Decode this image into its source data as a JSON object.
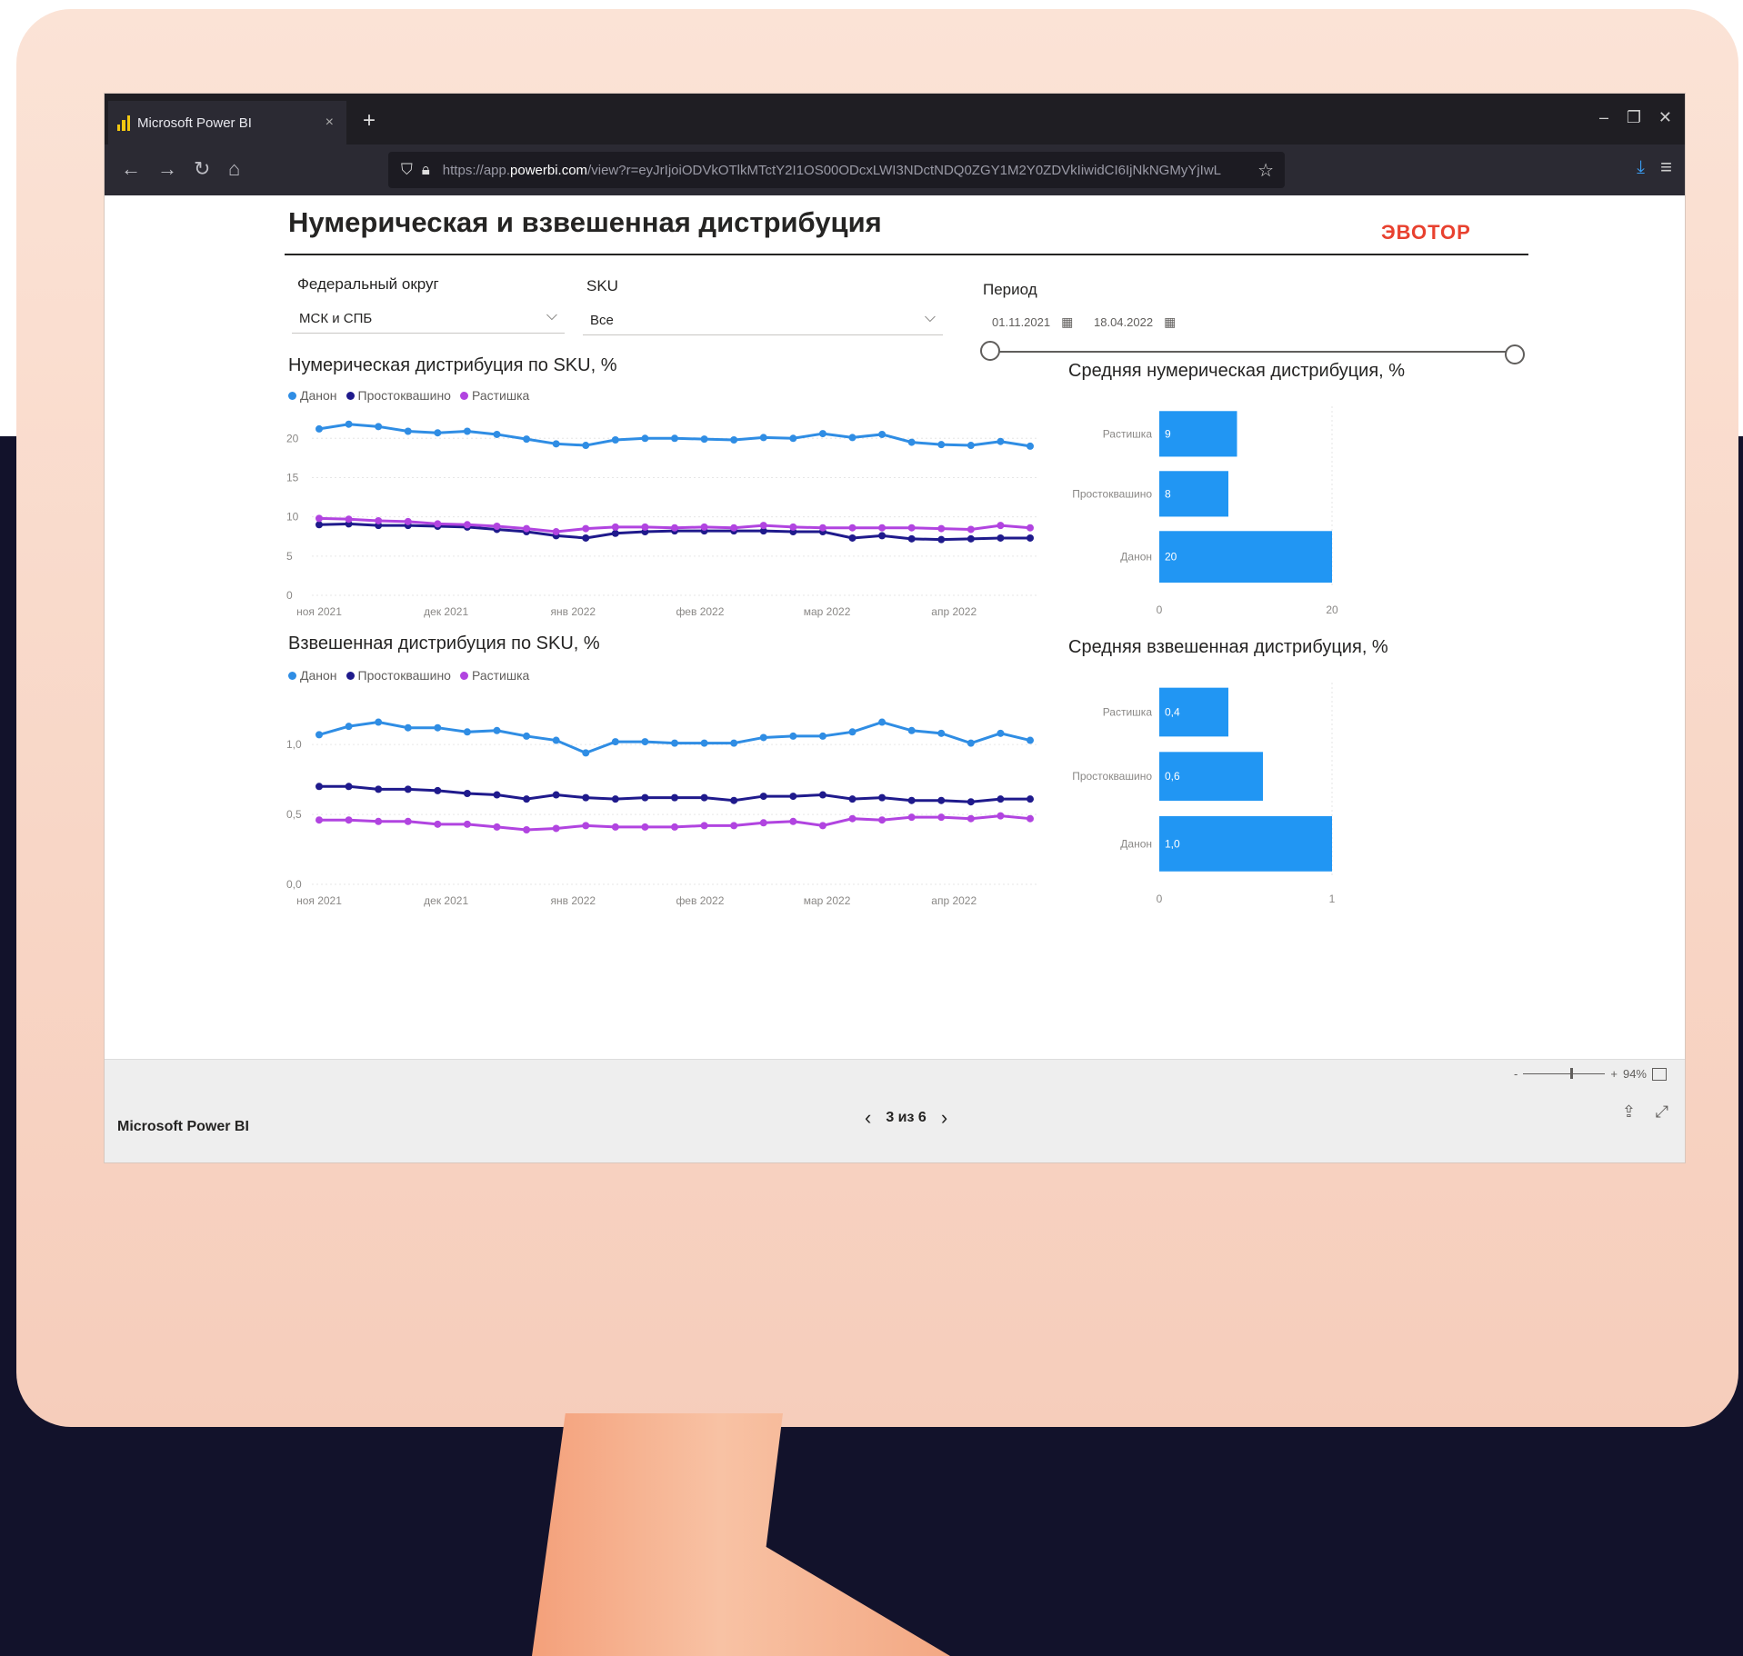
{
  "browser": {
    "tab_title": "Microsoft Power BI",
    "tab_close": "×",
    "new_tab": "+",
    "url_prefix": "https://app.",
    "url_domain": "powerbi.com",
    "url_rest": "/view?r=eyJrIjoiODVkOTlkMTctY2I1OS00ODcxLWI3NDctNDQ0ZGY1M2Y0ZDVkIiwidCI6IjNkNGMyYjIwL"
  },
  "report": {
    "title": "Нумерическая и взвешенная дистрибуция",
    "logo": "ЭВОТОР",
    "filters": {
      "district_label": "Федеральный округ",
      "district_value": "МСК и СПБ",
      "sku_label": "SKU",
      "sku_value": "Все",
      "period_label": "Период",
      "date_from": "01.11.2021",
      "date_to": "18.04.2022"
    },
    "legend": [
      "Данон",
      "Простоквашино",
      "Растишка"
    ]
  },
  "colors": {
    "danon": "#2f8de4",
    "prostokvashino": "#1f1a8c",
    "rastishka": "#b144e0",
    "bar": "#2196f3",
    "logo": "#e8412f"
  },
  "chart_data": [
    {
      "type": "line",
      "title": "Нумерическая дистрибуция по SKU, %",
      "ylim": [
        0,
        22
      ],
      "yticks": [
        "0",
        "5",
        "10",
        "15",
        "20"
      ],
      "xticks": [
        "ноя 2021",
        "дек 2021",
        "янв 2022",
        "фев 2022",
        "мар 2022",
        "апр 2022"
      ],
      "x_range": [
        "2021-11-01",
        "2022-04-18"
      ],
      "grid": true,
      "legend": "top-left",
      "series": [
        {
          "name": "Данон",
          "values": [
            21.2,
            21.8,
            21.5,
            20.9,
            20.7,
            20.9,
            20.5,
            19.9,
            19.3,
            19.1,
            19.8,
            20.0,
            20.0,
            19.9,
            19.8,
            20.1,
            20.0,
            20.6,
            20.1,
            20.5,
            19.5,
            19.2,
            19.1,
            19.6,
            19.0
          ]
        },
        {
          "name": "Простоквашино",
          "values": [
            9.0,
            9.1,
            8.9,
            8.9,
            8.8,
            8.7,
            8.4,
            8.1,
            7.6,
            7.3,
            7.9,
            8.1,
            8.2,
            8.2,
            8.2,
            8.2,
            8.1,
            8.1,
            7.3,
            7.6,
            7.2,
            7.1,
            7.2,
            7.3,
            7.3
          ]
        },
        {
          "name": "Растишка",
          "values": [
            9.8,
            9.7,
            9.5,
            9.4,
            9.1,
            9.0,
            8.8,
            8.5,
            8.1,
            8.5,
            8.7,
            8.7,
            8.6,
            8.7,
            8.6,
            8.9,
            8.7,
            8.6,
            8.6,
            8.6,
            8.6,
            8.5,
            8.4,
            8.9,
            8.6
          ]
        }
      ]
    },
    {
      "type": "bar",
      "title": "Средняя нумерическая дистрибуция, %",
      "categories": [
        "Растишка",
        "Простоквашино",
        "Данон"
      ],
      "values": [
        9,
        8,
        20
      ],
      "xticks": [
        "0",
        "20"
      ],
      "xlim": [
        0,
        20
      ]
    },
    {
      "type": "line",
      "title": "Взвешенная дистрибуция по SKU, %",
      "ylim": [
        0,
        1.3
      ],
      "yticks": [
        "0,0",
        "0,5",
        "1,0"
      ],
      "xticks": [
        "ноя 2021",
        "дек 2021",
        "янв 2022",
        "фев 2022",
        "мар 2022",
        "апр 2022"
      ],
      "x_range": [
        "2021-11-01",
        "2022-04-18"
      ],
      "grid": true,
      "legend": "top-left",
      "series": [
        {
          "name": "Данон",
          "values": [
            1.07,
            1.13,
            1.16,
            1.12,
            1.12,
            1.09,
            1.1,
            1.06,
            1.03,
            0.94,
            1.02,
            1.02,
            1.01,
            1.01,
            1.01,
            1.05,
            1.06,
            1.06,
            1.09,
            1.16,
            1.1,
            1.08,
            1.01,
            1.08,
            1.03
          ]
        },
        {
          "name": "Простоквашино",
          "values": [
            0.7,
            0.7,
            0.68,
            0.68,
            0.67,
            0.65,
            0.64,
            0.61,
            0.64,
            0.62,
            0.61,
            0.62,
            0.62,
            0.62,
            0.6,
            0.63,
            0.63,
            0.64,
            0.61,
            0.62,
            0.6,
            0.6,
            0.59,
            0.61,
            0.61
          ]
        },
        {
          "name": "Растишка",
          "values": [
            0.46,
            0.46,
            0.45,
            0.45,
            0.43,
            0.43,
            0.41,
            0.39,
            0.4,
            0.42,
            0.41,
            0.41,
            0.41,
            0.42,
            0.42,
            0.44,
            0.45,
            0.42,
            0.47,
            0.46,
            0.48,
            0.48,
            0.47,
            0.49,
            0.47
          ]
        }
      ]
    },
    {
      "type": "bar",
      "title": "Средняя взвешенная дистрибуция, %",
      "categories": [
        "Растишка",
        "Простоквашино",
        "Данон"
      ],
      "values": [
        0.4,
        0.6,
        1.0
      ],
      "labels": [
        "0,4",
        "0,6",
        "1,0"
      ],
      "xticks": [
        "0",
        "1"
      ],
      "xlim": [
        0,
        1
      ]
    }
  ],
  "footer": {
    "brand": "Microsoft Power BI",
    "page_indicator": "3 из 6",
    "zoom_minus": "-",
    "zoom_plus": "+",
    "zoom_level": "94%"
  }
}
